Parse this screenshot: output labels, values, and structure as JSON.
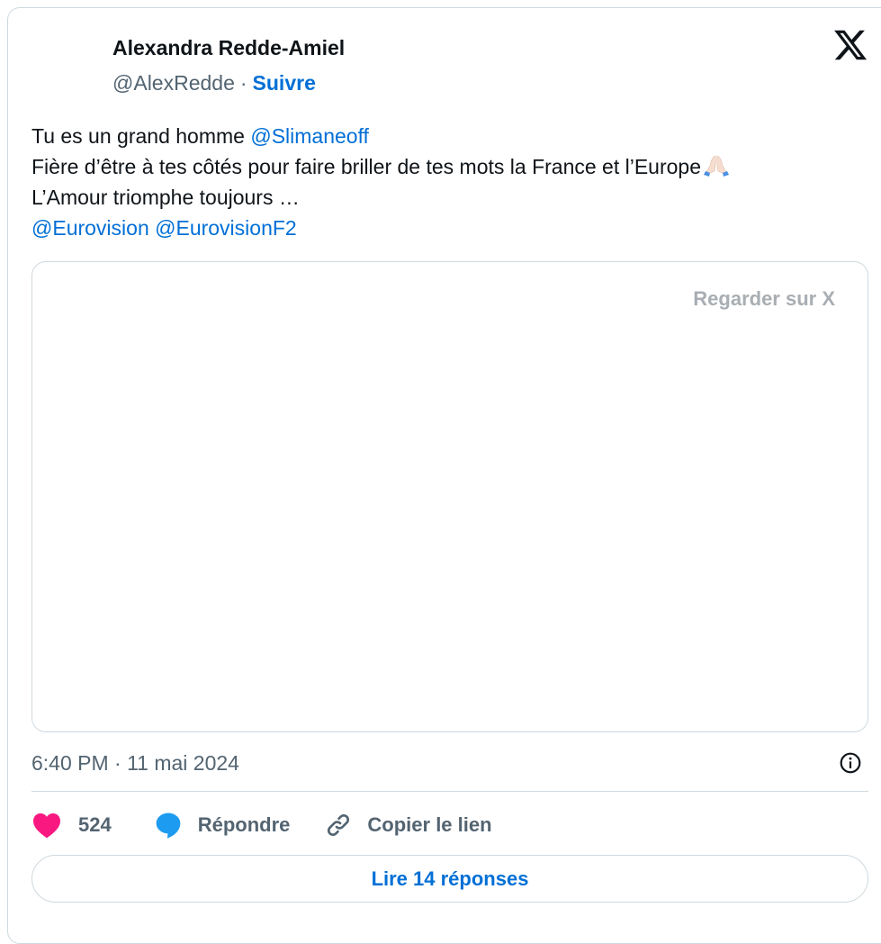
{
  "author": {
    "name": "Alexandra Redde-Amiel",
    "handle": "@AlexRedde",
    "separator": "·",
    "follow_label": "Suivre"
  },
  "tweet": {
    "line1_text": "Tu es un grand homme ",
    "line1_mention": "@Slimaneoff",
    "line2_text": "Fière d’être à tes côtés pour faire briller de tes mots la France et l’Europe",
    "line3_text": "L’Amour triomphe toujours …",
    "line4_mention1": "@Eurovision",
    "line4_mention2": "@EurovisionF2"
  },
  "media": {
    "watch_label": "Regarder sur X"
  },
  "meta": {
    "timestamp": "6:40 PM · 11 mai 2024"
  },
  "actions": {
    "like_count": "524",
    "reply_label": "Répondre",
    "copy_label": "Copier le lien",
    "read_replies_label": "Lire 14 réponses"
  },
  "icons": {
    "like": "heart-icon",
    "reply": "speech-bubble-icon",
    "copy": "link-icon",
    "info": "info-icon",
    "brand": "x-logo-icon",
    "emoji": "folded-hands-icon"
  },
  "colors": {
    "link": "#006fd6",
    "like": "#f91880",
    "reply": "#1d9bf0",
    "muted": "#536471",
    "border": "#cfd9de"
  }
}
